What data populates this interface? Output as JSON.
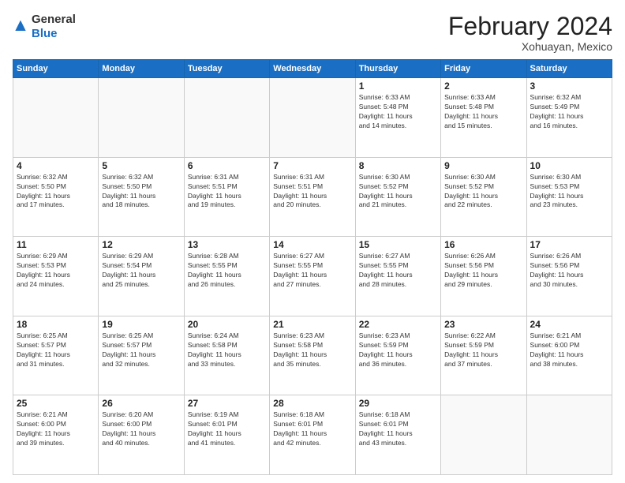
{
  "header": {
    "logo_general": "General",
    "logo_blue": "Blue",
    "month": "February 2024",
    "location": "Xohuayan, Mexico"
  },
  "days_of_week": [
    "Sunday",
    "Monday",
    "Tuesday",
    "Wednesday",
    "Thursday",
    "Friday",
    "Saturday"
  ],
  "weeks": [
    [
      {
        "day": "",
        "info": ""
      },
      {
        "day": "",
        "info": ""
      },
      {
        "day": "",
        "info": ""
      },
      {
        "day": "",
        "info": ""
      },
      {
        "day": "1",
        "info": "Sunrise: 6:33 AM\nSunset: 5:48 PM\nDaylight: 11 hours\nand 14 minutes."
      },
      {
        "day": "2",
        "info": "Sunrise: 6:33 AM\nSunset: 5:48 PM\nDaylight: 11 hours\nand 15 minutes."
      },
      {
        "day": "3",
        "info": "Sunrise: 6:32 AM\nSunset: 5:49 PM\nDaylight: 11 hours\nand 16 minutes."
      }
    ],
    [
      {
        "day": "4",
        "info": "Sunrise: 6:32 AM\nSunset: 5:50 PM\nDaylight: 11 hours\nand 17 minutes."
      },
      {
        "day": "5",
        "info": "Sunrise: 6:32 AM\nSunset: 5:50 PM\nDaylight: 11 hours\nand 18 minutes."
      },
      {
        "day": "6",
        "info": "Sunrise: 6:31 AM\nSunset: 5:51 PM\nDaylight: 11 hours\nand 19 minutes."
      },
      {
        "day": "7",
        "info": "Sunrise: 6:31 AM\nSunset: 5:51 PM\nDaylight: 11 hours\nand 20 minutes."
      },
      {
        "day": "8",
        "info": "Sunrise: 6:30 AM\nSunset: 5:52 PM\nDaylight: 11 hours\nand 21 minutes."
      },
      {
        "day": "9",
        "info": "Sunrise: 6:30 AM\nSunset: 5:52 PM\nDaylight: 11 hours\nand 22 minutes."
      },
      {
        "day": "10",
        "info": "Sunrise: 6:30 AM\nSunset: 5:53 PM\nDaylight: 11 hours\nand 23 minutes."
      }
    ],
    [
      {
        "day": "11",
        "info": "Sunrise: 6:29 AM\nSunset: 5:53 PM\nDaylight: 11 hours\nand 24 minutes."
      },
      {
        "day": "12",
        "info": "Sunrise: 6:29 AM\nSunset: 5:54 PM\nDaylight: 11 hours\nand 25 minutes."
      },
      {
        "day": "13",
        "info": "Sunrise: 6:28 AM\nSunset: 5:55 PM\nDaylight: 11 hours\nand 26 minutes."
      },
      {
        "day": "14",
        "info": "Sunrise: 6:27 AM\nSunset: 5:55 PM\nDaylight: 11 hours\nand 27 minutes."
      },
      {
        "day": "15",
        "info": "Sunrise: 6:27 AM\nSunset: 5:55 PM\nDaylight: 11 hours\nand 28 minutes."
      },
      {
        "day": "16",
        "info": "Sunrise: 6:26 AM\nSunset: 5:56 PM\nDaylight: 11 hours\nand 29 minutes."
      },
      {
        "day": "17",
        "info": "Sunrise: 6:26 AM\nSunset: 5:56 PM\nDaylight: 11 hours\nand 30 minutes."
      }
    ],
    [
      {
        "day": "18",
        "info": "Sunrise: 6:25 AM\nSunset: 5:57 PM\nDaylight: 11 hours\nand 31 minutes."
      },
      {
        "day": "19",
        "info": "Sunrise: 6:25 AM\nSunset: 5:57 PM\nDaylight: 11 hours\nand 32 minutes."
      },
      {
        "day": "20",
        "info": "Sunrise: 6:24 AM\nSunset: 5:58 PM\nDaylight: 11 hours\nand 33 minutes."
      },
      {
        "day": "21",
        "info": "Sunrise: 6:23 AM\nSunset: 5:58 PM\nDaylight: 11 hours\nand 35 minutes."
      },
      {
        "day": "22",
        "info": "Sunrise: 6:23 AM\nSunset: 5:59 PM\nDaylight: 11 hours\nand 36 minutes."
      },
      {
        "day": "23",
        "info": "Sunrise: 6:22 AM\nSunset: 5:59 PM\nDaylight: 11 hours\nand 37 minutes."
      },
      {
        "day": "24",
        "info": "Sunrise: 6:21 AM\nSunset: 6:00 PM\nDaylight: 11 hours\nand 38 minutes."
      }
    ],
    [
      {
        "day": "25",
        "info": "Sunrise: 6:21 AM\nSunset: 6:00 PM\nDaylight: 11 hours\nand 39 minutes."
      },
      {
        "day": "26",
        "info": "Sunrise: 6:20 AM\nSunset: 6:00 PM\nDaylight: 11 hours\nand 40 minutes."
      },
      {
        "day": "27",
        "info": "Sunrise: 6:19 AM\nSunset: 6:01 PM\nDaylight: 11 hours\nand 41 minutes."
      },
      {
        "day": "28",
        "info": "Sunrise: 6:18 AM\nSunset: 6:01 PM\nDaylight: 11 hours\nand 42 minutes."
      },
      {
        "day": "29",
        "info": "Sunrise: 6:18 AM\nSunset: 6:01 PM\nDaylight: 11 hours\nand 43 minutes."
      },
      {
        "day": "",
        "info": ""
      },
      {
        "day": "",
        "info": ""
      }
    ]
  ]
}
